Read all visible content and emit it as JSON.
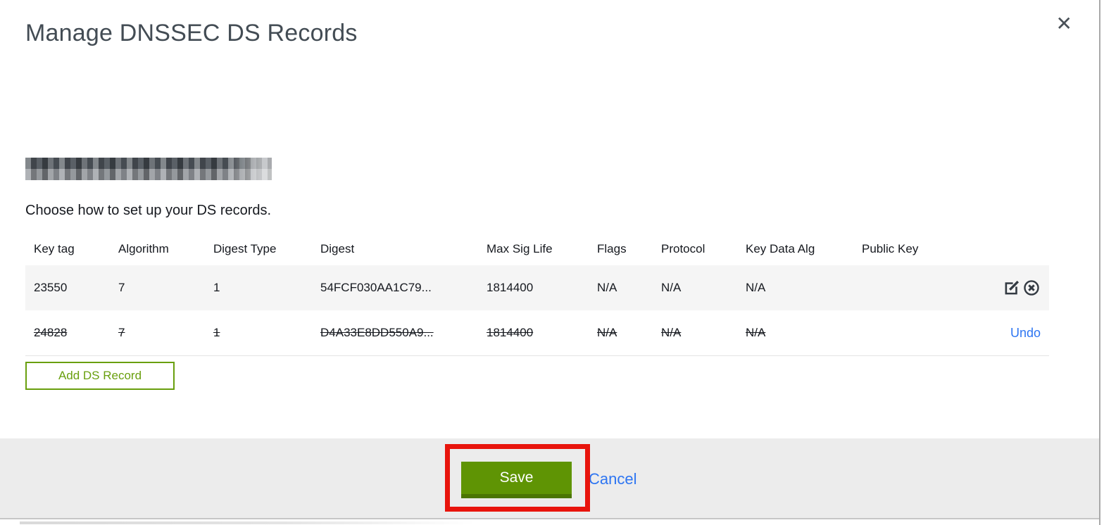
{
  "modal": {
    "title": "Manage DNSSEC DS Records",
    "close_icon": "✕",
    "instruction": "Choose how to set up your DS records.",
    "table": {
      "headers": [
        "Key tag",
        "Algorithm",
        "Digest Type",
        "Digest",
        "Max Sig Life",
        "Flags",
        "Protocol",
        "Key Data Alg",
        "Public Key"
      ],
      "rows": [
        {
          "key_tag": "23550",
          "algorithm": "7",
          "digest_type": "1",
          "digest": "54FCF030AA1C79...",
          "max_sig_life": "1814400",
          "flags": "N/A",
          "protocol": "N/A",
          "key_data_alg": "N/A",
          "public_key": "",
          "state": "normal"
        },
        {
          "key_tag": "24828",
          "algorithm": "7",
          "digest_type": "1",
          "digest": "D4A33E8DD550A9...",
          "max_sig_life": "1814400",
          "flags": "N/A",
          "protocol": "N/A",
          "key_data_alg": "N/A",
          "public_key": "",
          "state": "deleted",
          "undo_label": "Undo"
        }
      ]
    },
    "add_button_label": "Add DS Record",
    "footer": {
      "save_label": "Save",
      "cancel_label": "Cancel"
    }
  },
  "colors": {
    "button_green": "#5f9404",
    "button_green_shadow": "#4b7503",
    "outline_green": "#699f0e",
    "link_blue": "#2d75f2",
    "annotation_red": "#e8140c",
    "footer_bg": "#ececec",
    "row_highlight_bg": "#f5f5f5"
  }
}
